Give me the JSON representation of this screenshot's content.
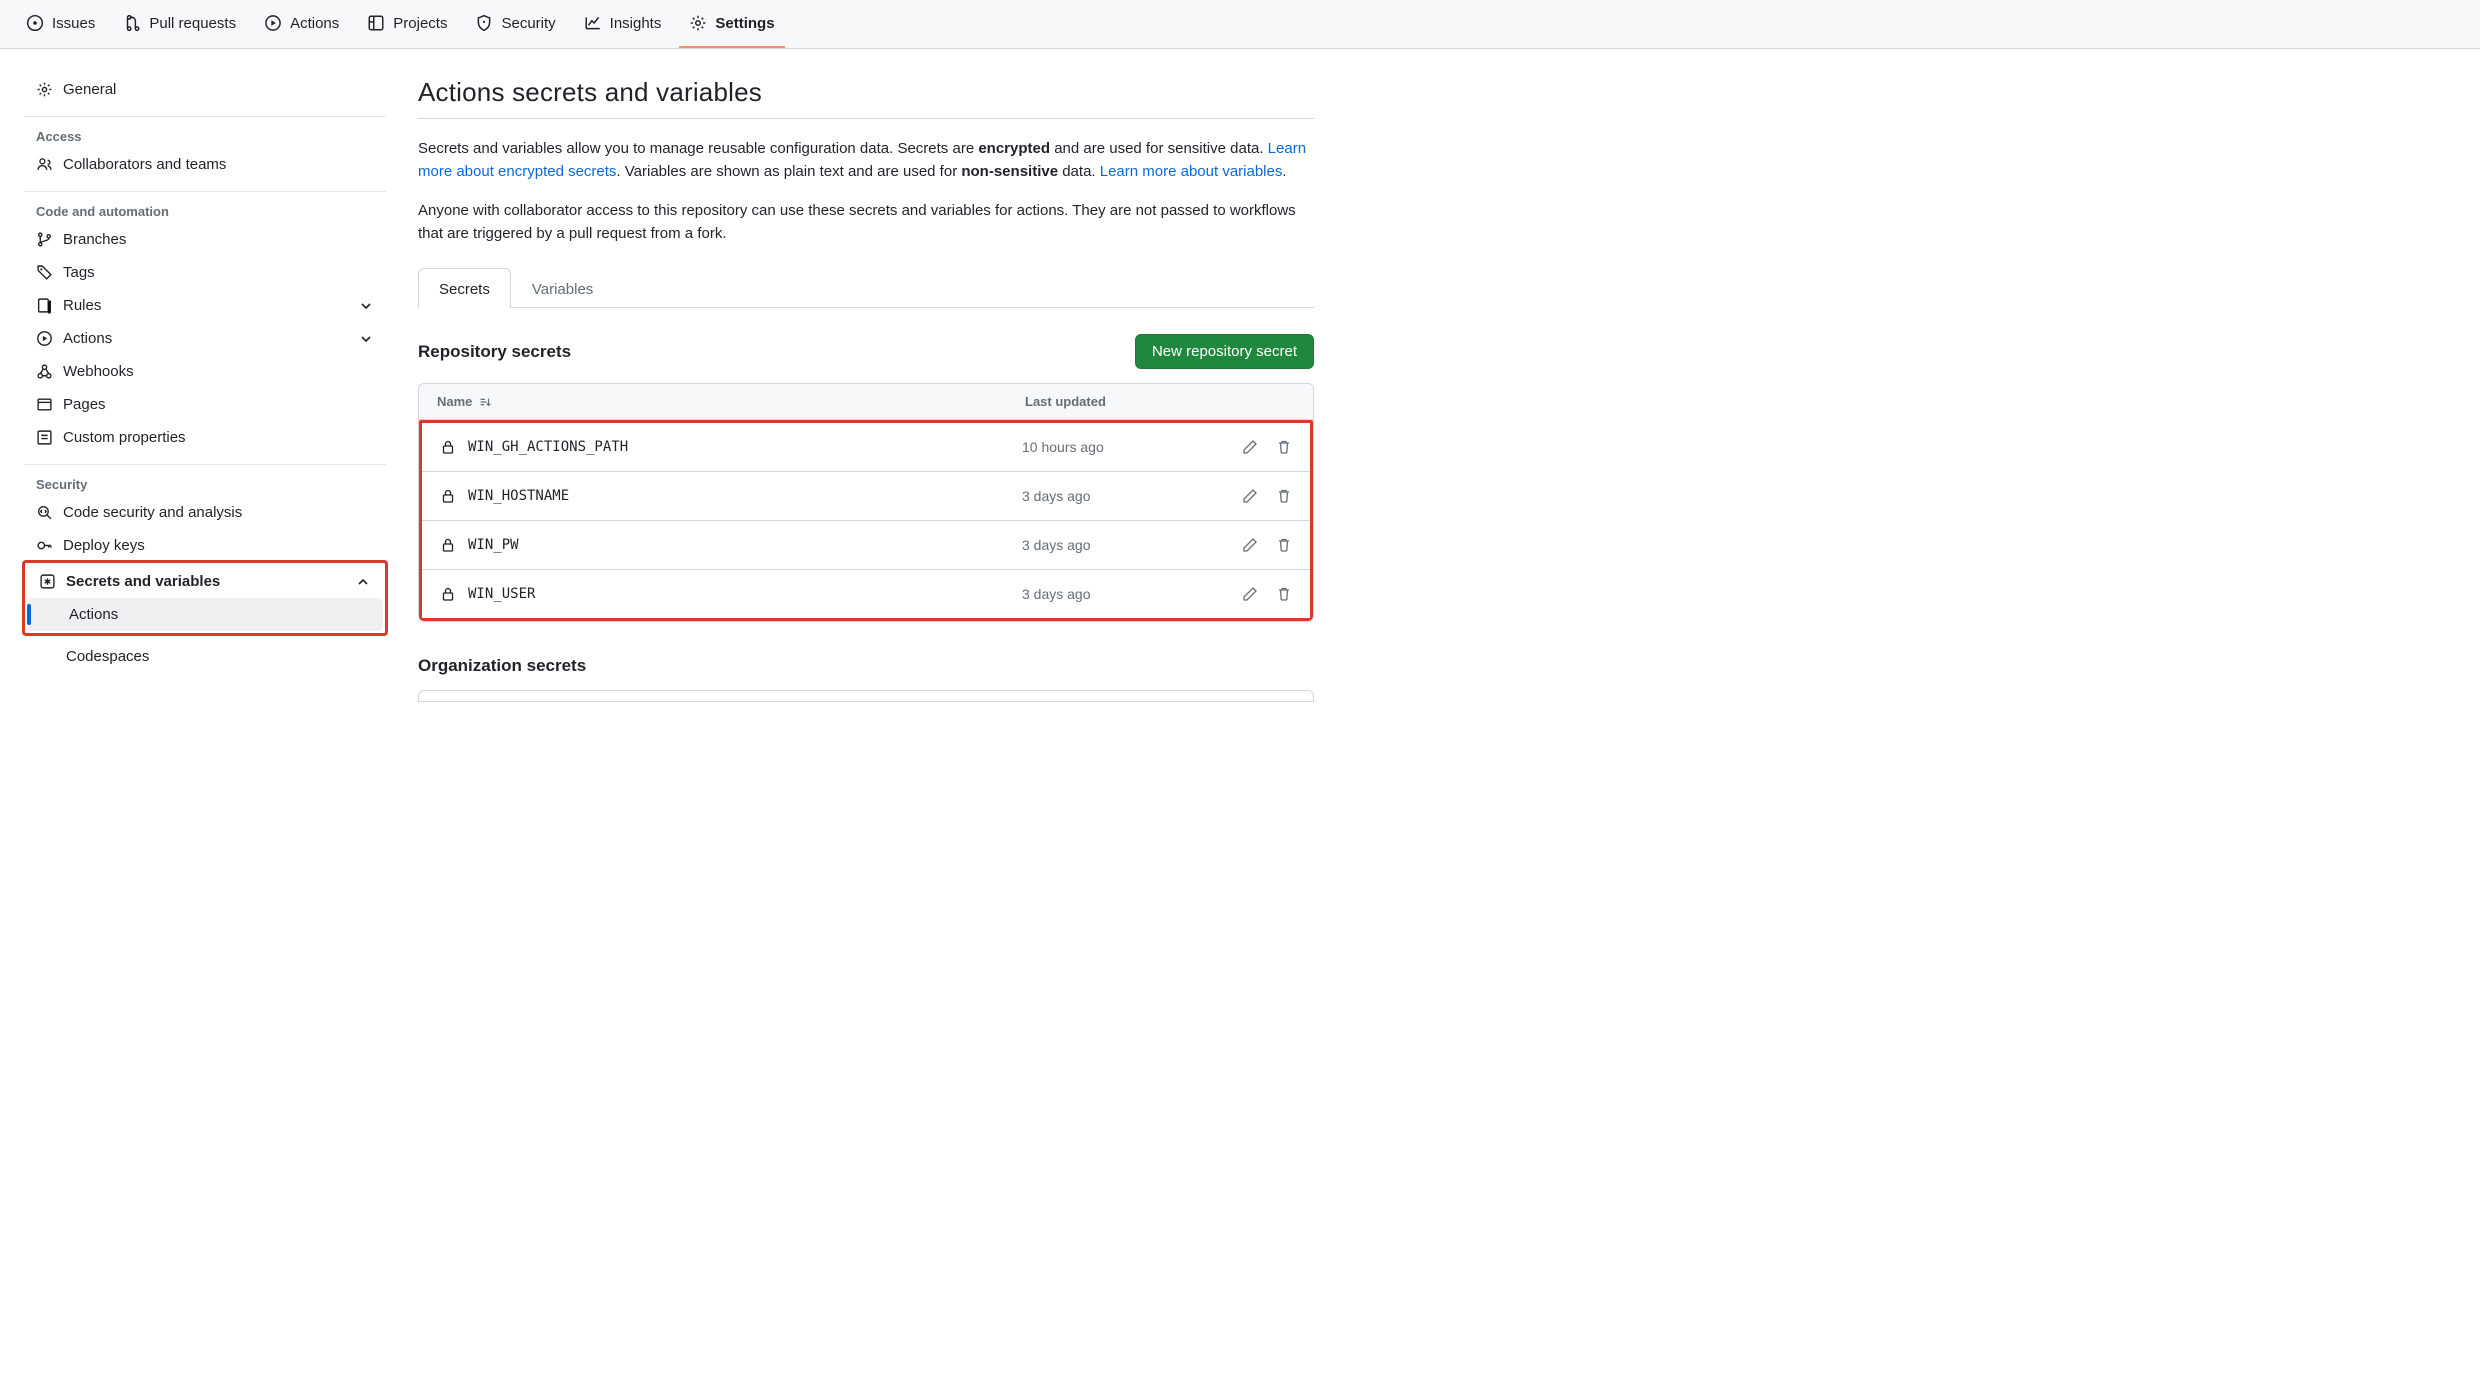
{
  "repoNav": {
    "issues": "Issues",
    "pulls": "Pull requests",
    "actions": "Actions",
    "projects": "Projects",
    "security": "Security",
    "insights": "Insights",
    "settings": "Settings"
  },
  "sidebar": {
    "general": "General",
    "access_heading": "Access",
    "collaborators": "Collaborators and teams",
    "code_heading": "Code and automation",
    "branches": "Branches",
    "tags": "Tags",
    "rules": "Rules",
    "actions": "Actions",
    "webhooks": "Webhooks",
    "pages": "Pages",
    "custom_properties": "Custom properties",
    "security_heading": "Security",
    "code_security": "Code security and analysis",
    "deploy_keys": "Deploy keys",
    "secrets_variables": "Secrets and variables",
    "sub_actions": "Actions",
    "sub_codespaces": "Codespaces"
  },
  "main": {
    "title": "Actions secrets and variables",
    "desc1_a": "Secrets and variables allow you to manage reusable configuration data. Secrets are ",
    "desc1_b": "encrypted",
    "desc1_c": " and are used for sensitive data. ",
    "link1": "Learn more about encrypted secrets",
    "desc1_d": ". Variables are shown as plain text and are used for ",
    "desc1_e": "non-sensitive",
    "desc1_f": " data. ",
    "link2": "Learn more about variables",
    "desc1_g": ".",
    "desc2": "Anyone with collaborator access to this repository can use these secrets and variables for actions. They are not passed to workflows that are triggered by a pull request from a fork.",
    "tabs": {
      "secrets": "Secrets",
      "variables": "Variables"
    },
    "repo_secrets_heading": "Repository secrets",
    "new_secret_btn": "New repository secret",
    "col_name": "Name",
    "col_updated": "Last updated",
    "secrets": [
      {
        "name": "WIN_GH_ACTIONS_PATH",
        "updated": "10 hours ago"
      },
      {
        "name": "WIN_HOSTNAME",
        "updated": "3 days ago"
      },
      {
        "name": "WIN_PW",
        "updated": "3 days ago"
      },
      {
        "name": "WIN_USER",
        "updated": "3 days ago"
      }
    ],
    "org_secrets_heading": "Organization secrets"
  }
}
